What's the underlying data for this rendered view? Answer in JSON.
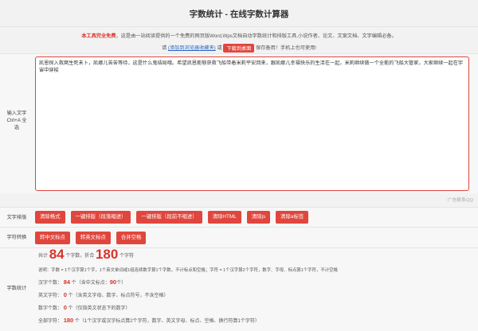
{
  "header": {
    "title": "字数统计 - 在线字数计算器"
  },
  "intro": {
    "free_label": "本工具完全免费",
    "description": "，这是由一站阅读提供的一个免费的网页版Word,Wps文档自动字数统计和排版工具,小说作者、论文、文案文档、文字编辑必备。",
    "please": "请",
    "bookmark_link": "(添加到浏览器收藏夹)",
    "or": "或",
    "download_label": "下载到桌面",
    "save_note": "保存备用！手机上也可使用!"
  },
  "input": {
    "label_line1": "输入文字",
    "label_line2": "Ctrl+A 全",
    "label_line3": "选",
    "text": "凯恩探入救窝生死未卜，凯娜儿苦苦等待，这是什么鬼结局哦。希望凯恩能够获救飞船带着米莉平安回来，跟凯娜儿幸福快乐的生活在一起，米莉继续做一个全能的飞船大管家，大家继续一起在宇宙中穿梭"
  },
  "ad_text": "广告联系QQ",
  "layout_row": {
    "label": "文字排版",
    "buttons": [
      "清除格式",
      "一键排版（段落缩进）",
      "一键排版（段前不缩进）",
      "清除HTML",
      "清除js",
      "清除a标签"
    ]
  },
  "convert_row": {
    "label": "字符转换",
    "buttons": [
      "转中文标点",
      "转英文标点",
      "合并空格"
    ]
  },
  "stats": {
    "label": "字数统计",
    "total_prefix": "共计",
    "total_words": "84",
    "total_words_unit": "个字数，折合",
    "total_chars": "180",
    "total_chars_unit": "个字符",
    "note": "说明：字数 = 1个汉字算1个字，1个英文单词或1组连续数字算1个字数，不计标点和空格；字符 = 1个汉字算2个字符，数字、字母、标点算1个字符，不计空格",
    "hanzi_label": "汉字个数：",
    "hanzi_count": "84",
    "hanzi_note": "个（含中文标点：",
    "hanzi_punct": "90",
    "hanzi_close": "个）",
    "en_label": "英文字符：",
    "en_count": "0",
    "en_note": "个（含英文字母、数字、标点符号，不含空格）",
    "num_label": "数字个数：",
    "num_count": "0",
    "num_note": "个（仅指英文状态下的数字）",
    "all_label": "全部字符：",
    "all_count": "180",
    "all_note": "个（1个汉字或汉字标点算2个字符，数字、英文字母、标点、空格、换行符算1个字符）"
  }
}
